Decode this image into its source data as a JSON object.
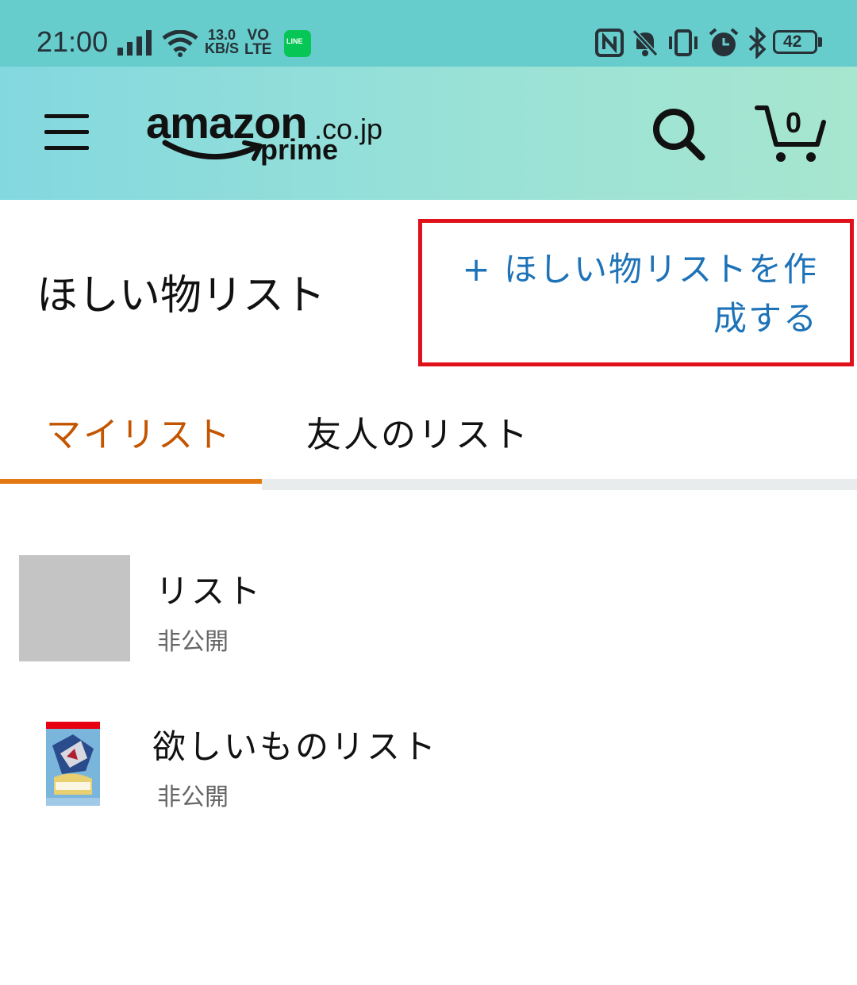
{
  "status_bar": {
    "time": "21:00",
    "speed_value": "13.0",
    "speed_unit": "KB/S",
    "volte_top": "VO",
    "volte_bottom": "LTE",
    "line_app": "LINE",
    "battery": "42"
  },
  "header": {
    "logo_main": "amazon",
    "logo_tld": ".co.jp",
    "logo_prime": "prime",
    "cart_count": "0"
  },
  "page": {
    "title": "ほしい物リスト",
    "create_button": "+ ほしい物リストを作成する"
  },
  "tabs": [
    {
      "label": "マイリスト",
      "active": true
    },
    {
      "label": "友人のリスト",
      "active": false
    }
  ],
  "lists": [
    {
      "title": "リスト",
      "visibility": "非公開",
      "thumbnail": "empty"
    },
    {
      "title": "欲しいものリスト",
      "visibility": "非公開",
      "thumbnail": "game-cover"
    }
  ],
  "colors": {
    "status_bar": "#66cccc",
    "header_gradient_start": "#83d8df",
    "header_gradient_end": "#a7e6cf",
    "link_blue": "#1d72b8",
    "active_tab": "#c45500",
    "tab_underline": "#e47911",
    "highlight_box": "#e0111b"
  }
}
